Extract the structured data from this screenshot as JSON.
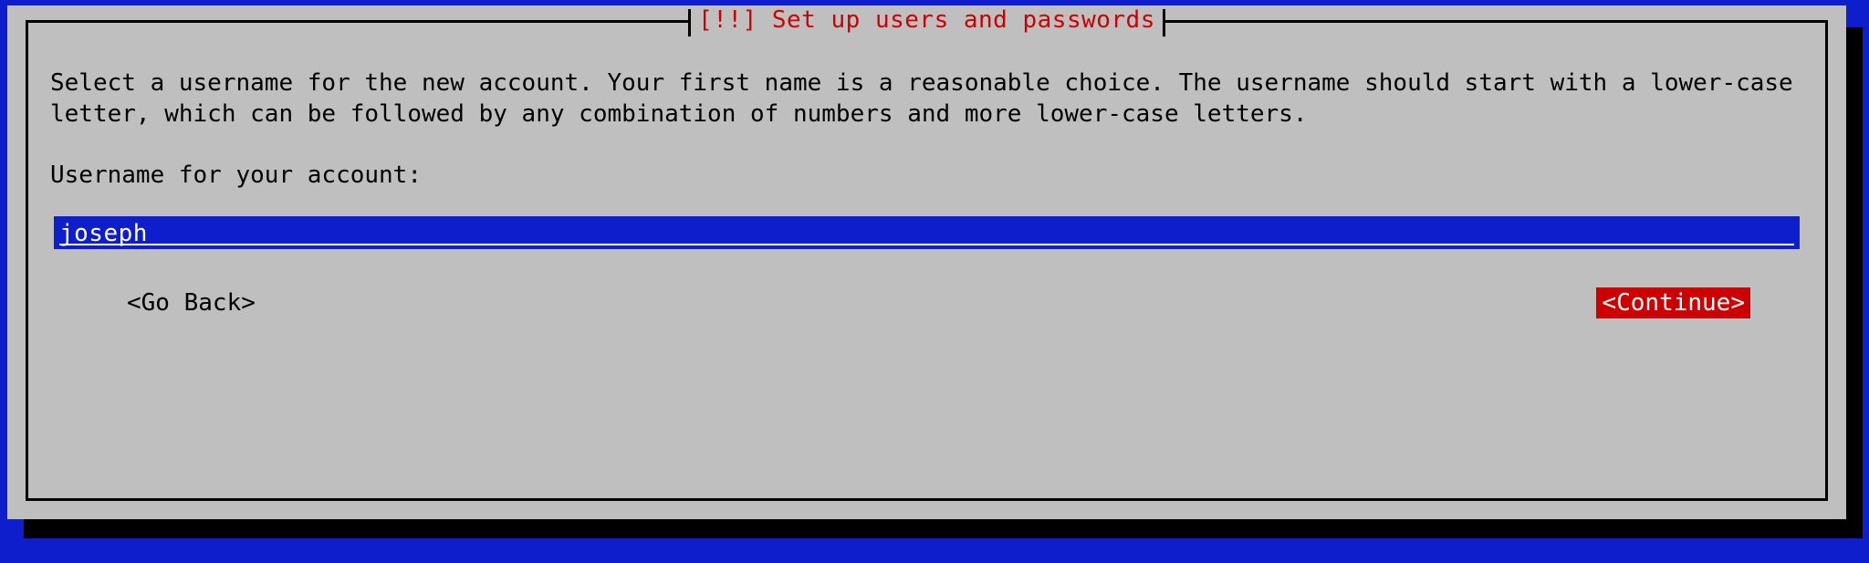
{
  "dialog": {
    "title": "[!!] Set up users and passwords",
    "description": "Select a username for the new account. Your first name is a reasonable choice. The username should start with a lower-case letter, which can be followed by any combination of numbers and more lower-case letters.",
    "prompt_label": "Username for your account:",
    "input_value": "joseph",
    "buttons": {
      "back": "<Go Back>",
      "continue": "<Continue>"
    }
  },
  "colors": {
    "background": "#0e1ecd",
    "panel": "#bfbfbf",
    "accent_red": "#cc0000",
    "shadow": "#000000"
  }
}
